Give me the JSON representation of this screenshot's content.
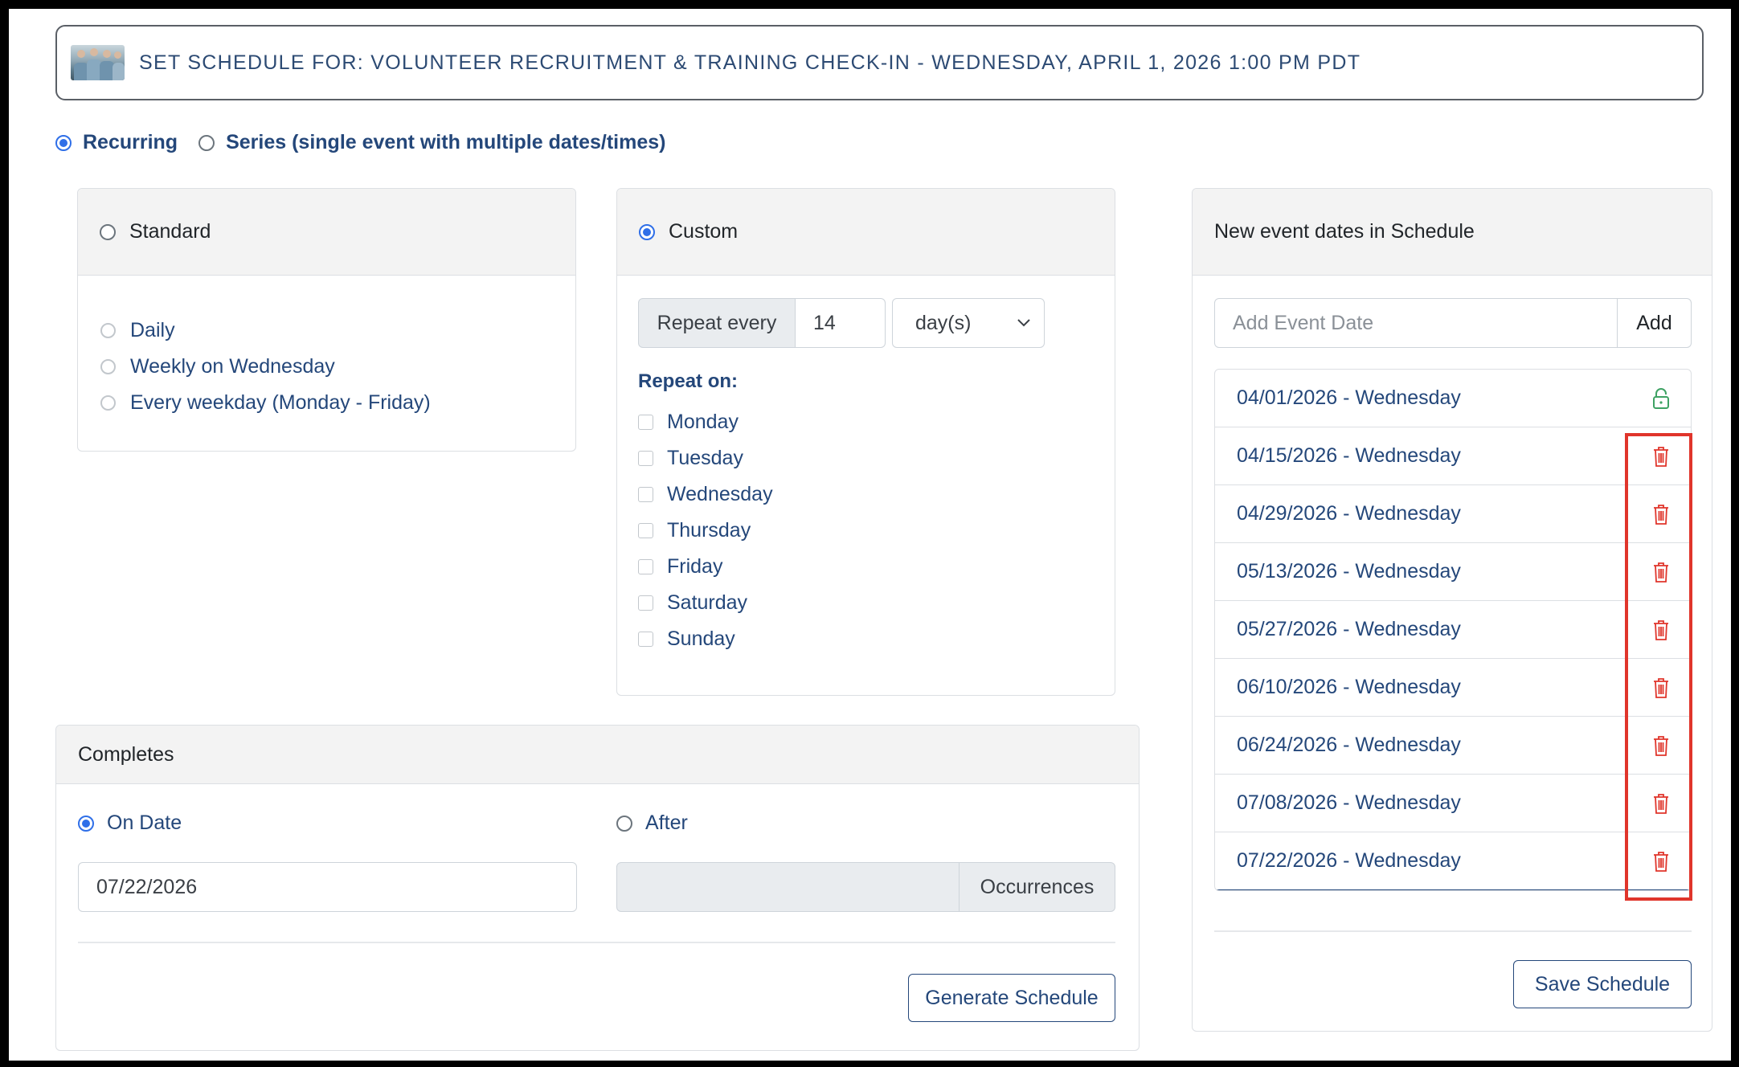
{
  "header": {
    "title": "SET SCHEDULE FOR: VOLUNTEER RECRUITMENT & TRAINING CHECK-IN - WEDNESDAY, APRIL 1, 2026 1:00 PM PDT"
  },
  "mode": {
    "recurring_label": "Recurring",
    "series_label": "Series (single event with multiple dates/times)",
    "selected": "recurring"
  },
  "standard": {
    "title": "Standard",
    "options": [
      {
        "label": "Daily"
      },
      {
        "label": "Weekly on Wednesday"
      },
      {
        "label": "Every weekday (Monday - Friday)"
      }
    ]
  },
  "custom": {
    "title": "Custom",
    "repeat_every_label": "Repeat every",
    "repeat_every_value": "14",
    "unit_selected": "day(s)",
    "repeat_on_label": "Repeat on:",
    "days": [
      {
        "label": "Monday",
        "checked": false
      },
      {
        "label": "Tuesday",
        "checked": false
      },
      {
        "label": "Wednesday",
        "checked": false
      },
      {
        "label": "Thursday",
        "checked": false
      },
      {
        "label": "Friday",
        "checked": false
      },
      {
        "label": "Saturday",
        "checked": false
      },
      {
        "label": "Sunday",
        "checked": false
      }
    ]
  },
  "completes": {
    "title": "Completes",
    "on_date_label": "On Date",
    "on_date_value": "07/22/2026",
    "after_label": "After",
    "occurrences_label": "Occurrences",
    "generate_button": "Generate Schedule"
  },
  "schedule": {
    "title": "New event dates in Schedule",
    "add_placeholder": "Add Event Date",
    "add_button": "Add",
    "dates": [
      {
        "label": "04/01/2026 - Wednesday",
        "icon": "lock-icon"
      },
      {
        "label": "04/15/2026 - Wednesday",
        "icon": "trash-icon"
      },
      {
        "label": "04/29/2026 - Wednesday",
        "icon": "trash-icon"
      },
      {
        "label": "05/13/2026 - Wednesday",
        "icon": "trash-icon"
      },
      {
        "label": "05/27/2026 - Wednesday",
        "icon": "trash-icon"
      },
      {
        "label": "06/10/2026 - Wednesday",
        "icon": "trash-icon"
      },
      {
        "label": "06/24/2026 - Wednesday",
        "icon": "trash-icon"
      },
      {
        "label": "07/08/2026 - Wednesday",
        "icon": "trash-icon"
      },
      {
        "label": "07/22/2026 - Wednesday",
        "icon": "trash-icon"
      }
    ],
    "save_button": "Save Schedule"
  },
  "colors": {
    "primary_text": "#24477a",
    "radio_selected": "#2f6fe8",
    "trash": "#e0352b",
    "lock": "#3fa264",
    "highlight": "#e0352b"
  }
}
